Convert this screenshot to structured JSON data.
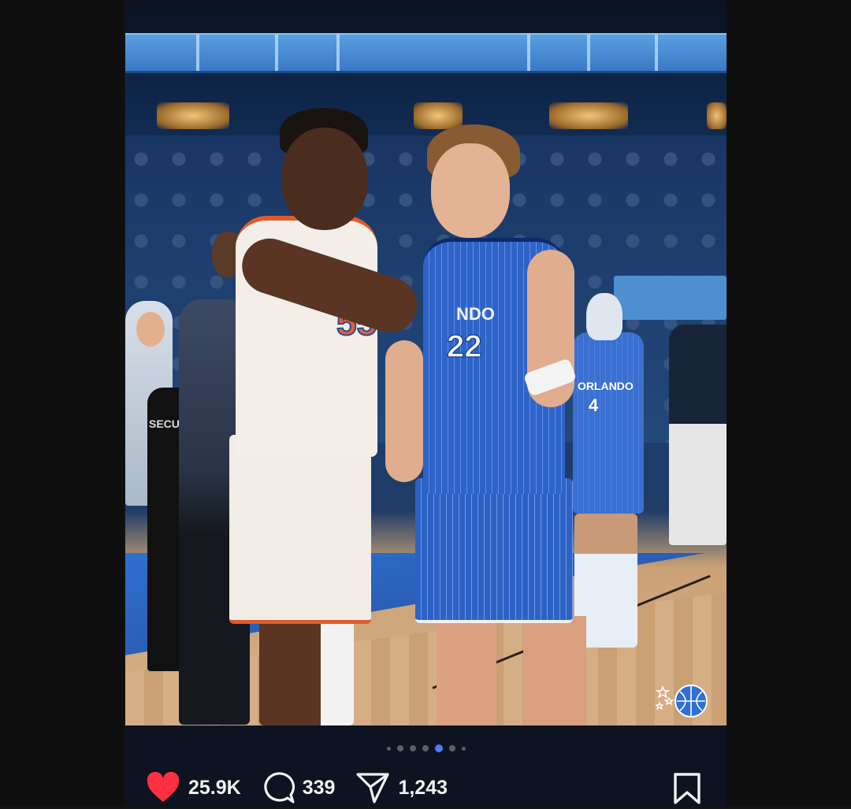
{
  "post": {
    "photo_overlay_text": {
      "knicks_number": "55",
      "magic_number": "22",
      "magic_chest_text": "NDO",
      "background_player_text": "ORLANDO",
      "background_player_number": "4",
      "security_text": "SECU"
    },
    "carousel": {
      "total_dots": 7,
      "active_index": 4
    },
    "actions": {
      "likes": "25.9K",
      "comments": "339",
      "shares": "1,243",
      "like_icon": "heart-icon",
      "comment_icon": "comment-bubble-icon",
      "share_icon": "send-icon",
      "save_icon": "bookmark-icon",
      "like_color": "#ff3040"
    },
    "watermark_logo": "orlando-magic-logo"
  }
}
